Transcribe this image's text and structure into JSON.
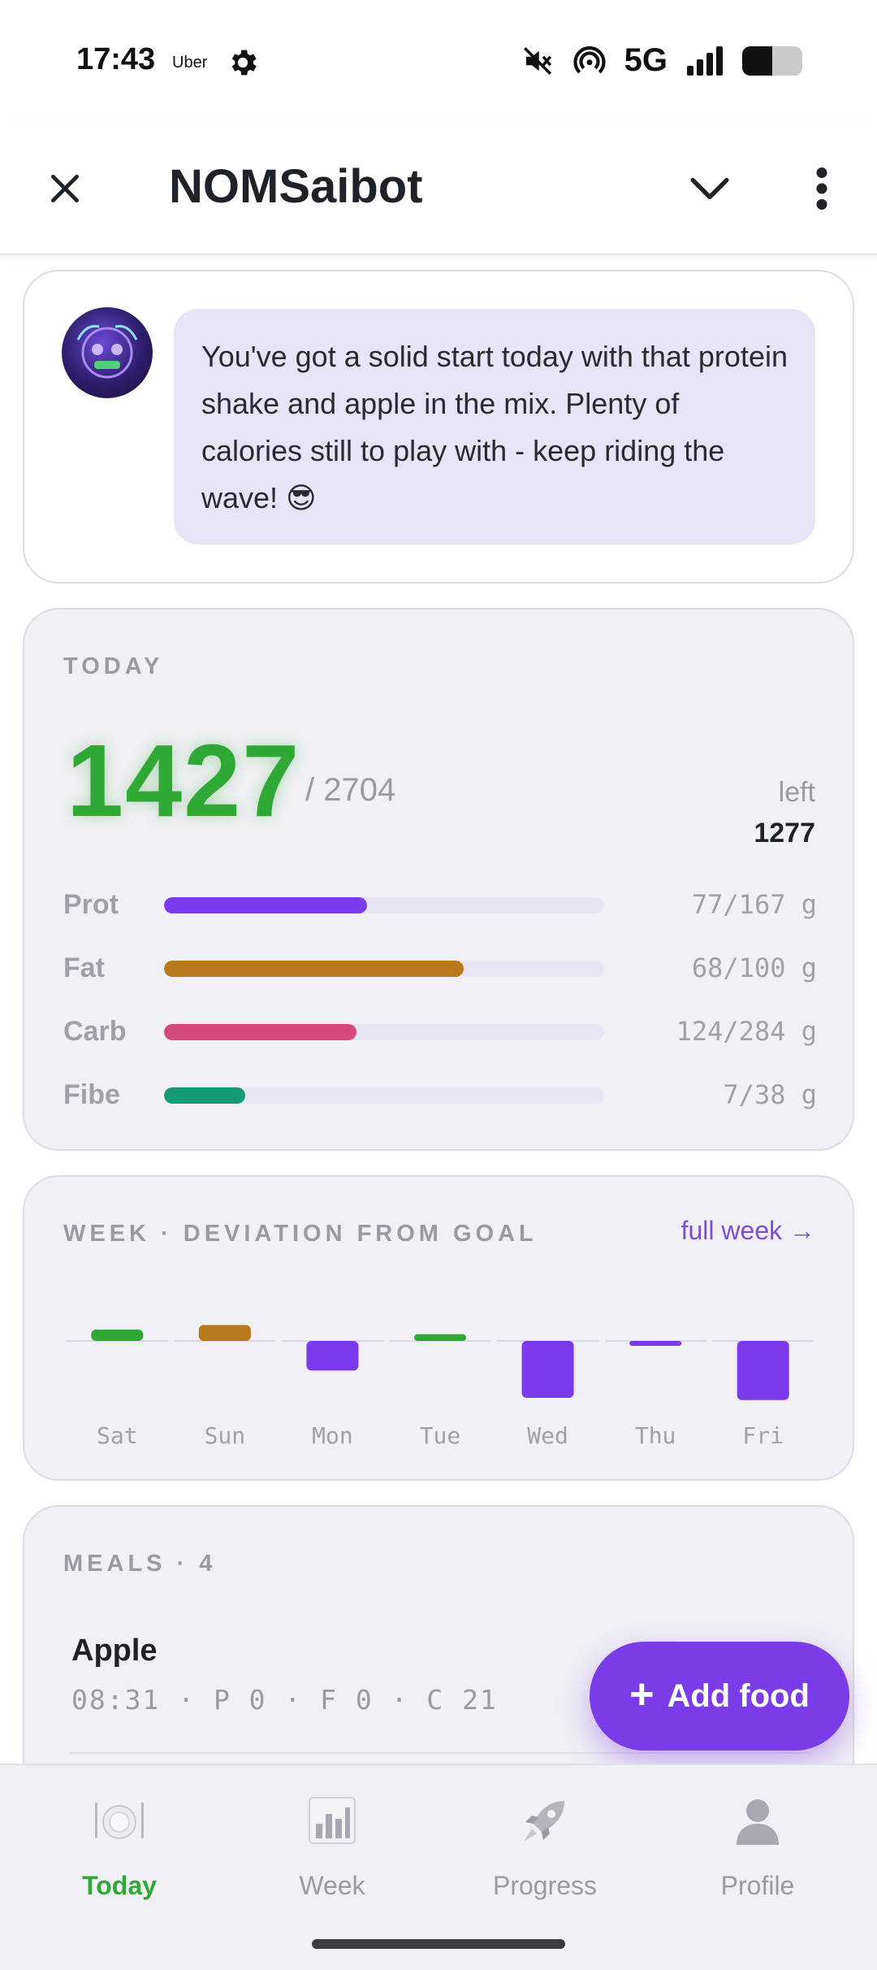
{
  "status_bar": {
    "time": "17:43",
    "app_notification": "Uber",
    "network": "5G",
    "battery_level": 0.5,
    "icons": [
      "gear-icon",
      "mute-icon",
      "hotspot-icon",
      "signal-icon",
      "battery-icon"
    ]
  },
  "app_bar": {
    "title": "NOMSaibot",
    "icons": [
      "close-icon",
      "chevron-down-icon",
      "more-vert-icon"
    ]
  },
  "coach": {
    "message": "You've got a solid start today with that protein shake and apple in the mix. Plenty of calories still to play with - keep riding the wave! 😎"
  },
  "today": {
    "label": "TODAY",
    "calories": "1427",
    "goal": "/ 2704",
    "left_label": "left",
    "left_value": "1277",
    "macros": [
      {
        "name": "Prot",
        "value": "77/167 g",
        "fraction": 0.461,
        "color": "#7c3aed"
      },
      {
        "name": "Fat",
        "value": "68/100 g",
        "fraction": 0.68,
        "color": "#b9781a"
      },
      {
        "name": "Carb",
        "value": "124/284 g",
        "fraction": 0.437,
        "color": "#d54a7d"
      },
      {
        "name": "Fibe",
        "value": "7/38 g",
        "fraction": 0.184,
        "color": "#159a78"
      }
    ]
  },
  "week": {
    "label": "WEEK · DEVIATION FROM GOAL",
    "link": "full week →",
    "colors": {
      "under": "#7c3aed",
      "over_small": "#2fa836",
      "over_large": "#b9781a"
    }
  },
  "chart_data": {
    "type": "bar",
    "categories": [
      "Sat",
      "Sun",
      "Mon",
      "Tue",
      "Wed",
      "Thu",
      "Fri"
    ],
    "values": [
      0.1,
      0.14,
      -0.26,
      0.06,
      -0.5,
      -0.04,
      -0.52
    ],
    "bar_colors": [
      "#2fa836",
      "#b9781a",
      "#7c3aed",
      "#2fa836",
      "#7c3aed",
      "#7c3aed",
      "#7c3aed"
    ],
    "ylim": [
      -0.6,
      0.6
    ],
    "grid": false
  },
  "meals": {
    "label": "MEALS · 4",
    "items": [
      {
        "name": "Apple",
        "meta": "08:31 · P 0 · F 0 · C 21"
      }
    ]
  },
  "fab": {
    "plus": "+",
    "label": "Add food"
  },
  "nav": {
    "items": [
      {
        "label": "Today",
        "icon": "plate-icon",
        "active": true
      },
      {
        "label": "Week",
        "icon": "bar-chart-icon",
        "active": false
      },
      {
        "label": "Progress",
        "icon": "rocket-icon",
        "active": false
      },
      {
        "label": "Profile",
        "icon": "person-icon",
        "active": false
      }
    ]
  }
}
